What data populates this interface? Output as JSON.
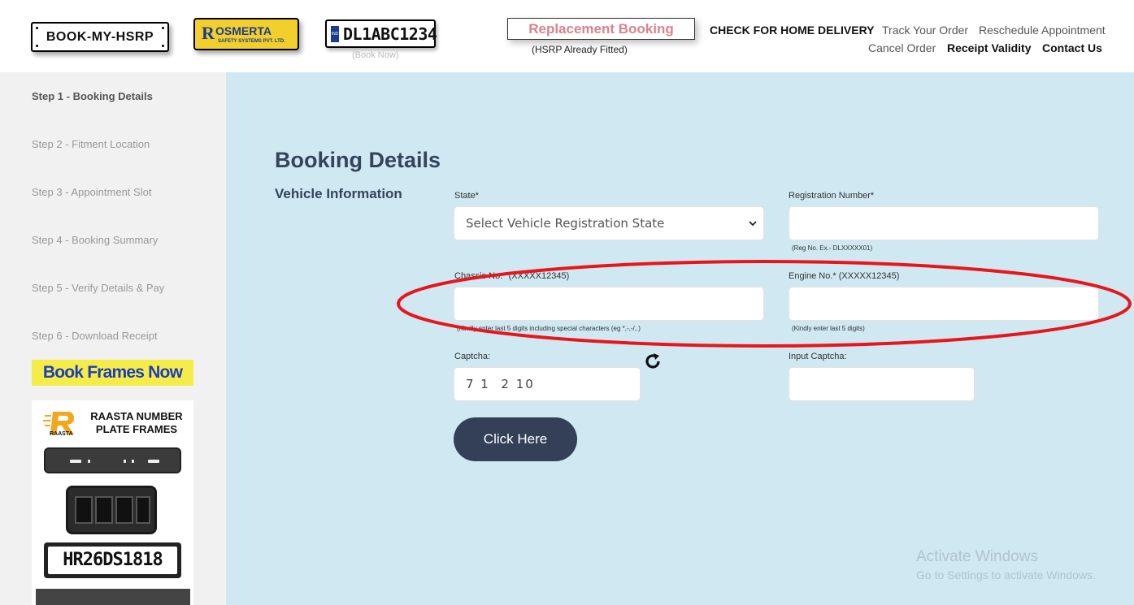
{
  "header": {
    "logo_text": "BOOK-MY-HSRP",
    "partner_logo": {
      "letter": "R",
      "name": "OSMERTA",
      "subtitle": "SAFETY SYSTEMS PVT. LTD."
    },
    "plate_logo": {
      "country": "IND",
      "number": "DL1ABC1234"
    },
    "book_now": "(Book Now)",
    "replacement_label": "Replacement Booking",
    "replacement_sub": "(HSRP Already Fitted)",
    "nav": {
      "home_delivery": "CHECK FOR HOME DELIVERY",
      "track_order": "Track Your Order",
      "reschedule": "Reschedule Appointment",
      "cancel_order": "Cancel Order",
      "receipt_validity": "Receipt Validity",
      "contact_us": "Contact Us"
    }
  },
  "sidebar": {
    "steps": [
      "Step 1 - Booking Details",
      "Step 2 - Fitment Location",
      "Step 3 - Appointment Slot",
      "Step 4 - Booking Summary",
      "Step 5 - Verify Details & Pay",
      "Step 6 - Download Receipt"
    ],
    "frames_button": "Book Frames Now",
    "ad": {
      "brand_small": "RAASTA",
      "title": "RAASTA NUMBER PLATE FRAMES",
      "plate_text": "HR26DS1818"
    }
  },
  "main": {
    "page_title": "Booking Details",
    "section_title": "Vehicle Information",
    "state": {
      "label": "State*",
      "value": "Select Vehicle Registration State"
    },
    "registration": {
      "label": "Registration Number*",
      "value": "",
      "hint": "(Reg No. Ex.- DLXXXXX01)"
    },
    "chassis": {
      "label": "Chassis No.* (XXXXX12345)",
      "value": "",
      "hint": "(Kindly enter last 5 digits including special characters (eg *,-,-/,.)"
    },
    "engine": {
      "label": "Engine No.* (XXXXX12345)",
      "value": "",
      "hint": "(Kindly enter last 5 digits)"
    },
    "captcha": {
      "label": "Captcha:",
      "value": "7 1  2 10"
    },
    "input_captcha": {
      "label": "Input Captcha:",
      "value": ""
    },
    "submit_label": "Click Here"
  },
  "watermark": {
    "line1": "Activate Windows",
    "line2": "Go to Settings to activate Windows."
  },
  "colors": {
    "main_bg": "#cfe8f2",
    "sidebar_bg": "#f1f1f1",
    "button_bg": "#334058",
    "annotation": "#e8161b"
  }
}
